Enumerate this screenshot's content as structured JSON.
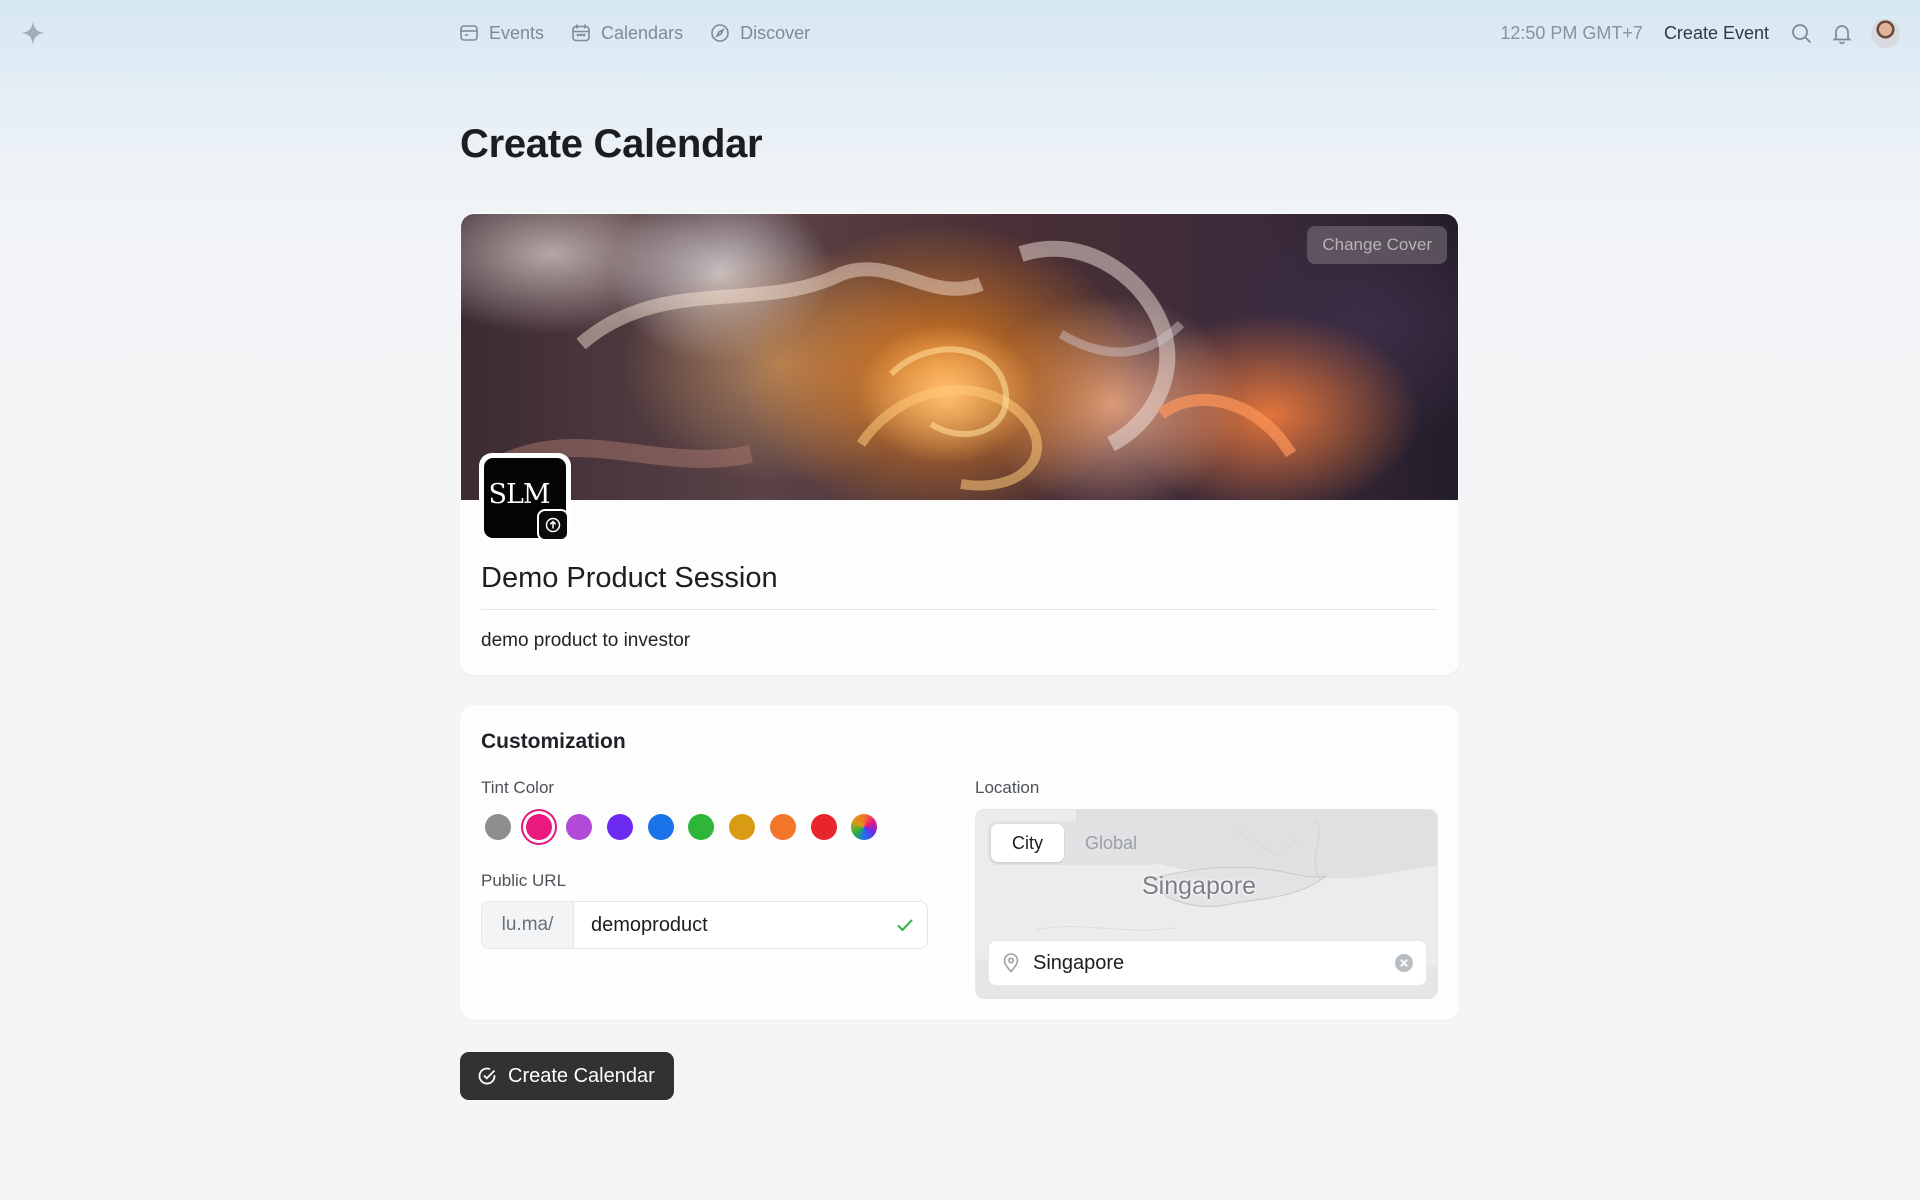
{
  "nav": {
    "items": [
      {
        "label": "Events",
        "icon": "calendar-ticket-icon"
      },
      {
        "label": "Calendars",
        "icon": "calendar-icon"
      },
      {
        "label": "Discover",
        "icon": "compass-icon"
      }
    ],
    "time": "12:50 PM GMT+7",
    "create_event": "Create Event"
  },
  "page": {
    "title": "Create Calendar"
  },
  "calendar": {
    "change_cover": "Change Cover",
    "avatar_text": "SLM",
    "name": "Demo Product Session",
    "description": "demo product to investor"
  },
  "customization": {
    "title": "Customization",
    "tint_label": "Tint Color",
    "tint_colors": [
      "#8e8e90",
      "#e9197f",
      "#b34ad8",
      "#6b2bf0",
      "#1a73e8",
      "#2eb53a",
      "#d99b13",
      "#f2752a",
      "#e8252d",
      "rainbow"
    ],
    "selected_tint": "#e9197f",
    "url_label": "Public URL",
    "url_prefix": "lu.ma/",
    "url_value": "demoproduct",
    "location_label": "Location",
    "location_tabs": [
      "City",
      "Global"
    ],
    "location_active_tab": "City",
    "map_label": "Singapore",
    "location_value": "Singapore"
  },
  "actions": {
    "create_calendar": "Create Calendar"
  }
}
